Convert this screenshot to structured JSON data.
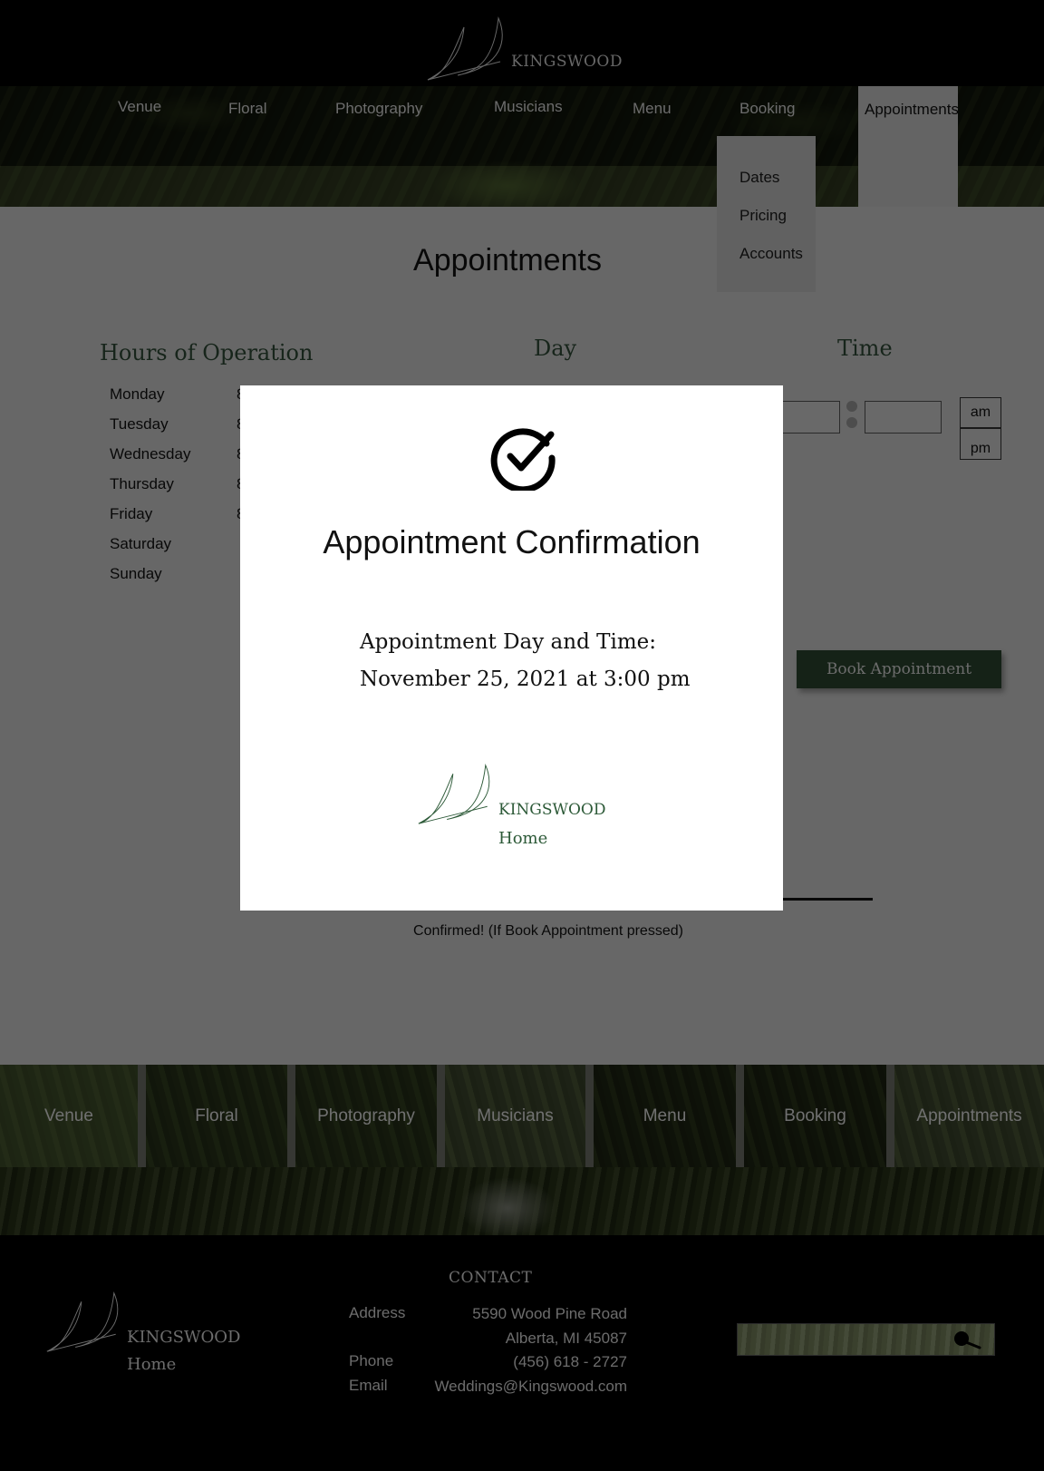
{
  "brand": {
    "name": "KINGSWOOD",
    "home": "Home"
  },
  "nav": {
    "items": [
      {
        "label": "Venue"
      },
      {
        "label": "Floral"
      },
      {
        "label": "Photography"
      },
      {
        "label": "Musicians"
      },
      {
        "label": "Menu"
      },
      {
        "label": "Booking"
      },
      {
        "label": "Appointments"
      }
    ],
    "booking_dropdown": [
      "Dates",
      "Pricing",
      "Accounts"
    ]
  },
  "page": {
    "title": "Appointments",
    "hours_title": "Hours of Operation",
    "hours": [
      {
        "day": "Monday",
        "value": "8"
      },
      {
        "day": "Tuesday",
        "value": "8"
      },
      {
        "day": "Wednesday",
        "value": "8"
      },
      {
        "day": "Thursday",
        "value": "8"
      },
      {
        "day": "Friday",
        "value": "8"
      },
      {
        "day": "Saturday",
        "value": ""
      },
      {
        "day": "Sunday",
        "value": ""
      }
    ],
    "day_heading": "Day",
    "time_heading": "Time",
    "am_label": "am",
    "pm_label": "pm",
    "book_button": "Book Appointment",
    "confirmed_note": "Confirmed! (If Book Appointment pressed)"
  },
  "bottom_nav": [
    "Venue",
    "Floral",
    "Photography",
    "Musicians",
    "Menu",
    "Booking",
    "Appointments"
  ],
  "footer": {
    "contact_title": "CONTACT",
    "address_label": "Address",
    "address_line1": "5590 Wood Pine Road",
    "address_line2": "Alberta, MI 45087",
    "phone_label": "Phone",
    "phone": "(456) 618 - 2727",
    "email_label": "Email",
    "email": "Weddings@Kingswood.com"
  },
  "modal": {
    "title": "Appointment Confirmation",
    "line1": "Appointment Day and Time:",
    "line2": "November 25, 2021 at 3:00 pm"
  },
  "colors": {
    "accent_green": "#2a452f",
    "heading_green": "#2f4a36",
    "logo_green": "#2d5a38"
  },
  "icons": [
    "kingswood-leaf-logo-icon",
    "check-circle-icon",
    "search-icon"
  ]
}
